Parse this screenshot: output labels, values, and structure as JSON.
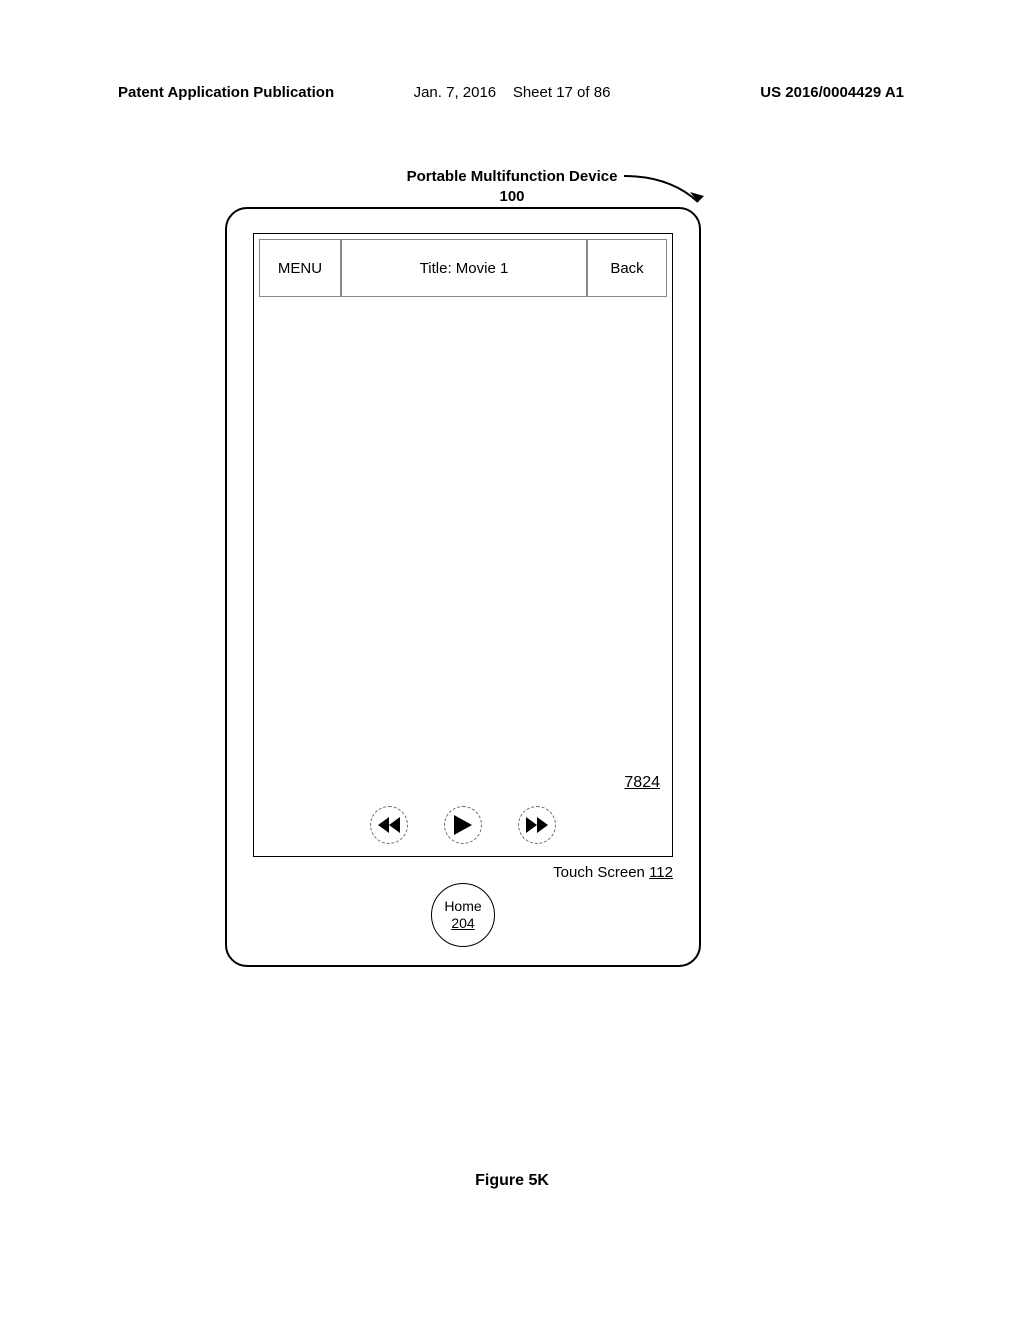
{
  "header": {
    "left": "Patent Application Publication",
    "date": "Jan. 7, 2016",
    "sheet": "Sheet 17 of 86",
    "pubnum": "US 2016/0004429 A1"
  },
  "device": {
    "title_line1": "Portable Multifunction Device",
    "title_ref": "100",
    "topbar": {
      "menu": "MENU",
      "title": "Title: Movie 1",
      "back": "Back"
    },
    "content_ref": "7824",
    "touch_label": "Touch Screen",
    "touch_ref": "112",
    "home_label": "Home",
    "home_ref": "204"
  },
  "figure_label": "Figure 5K"
}
